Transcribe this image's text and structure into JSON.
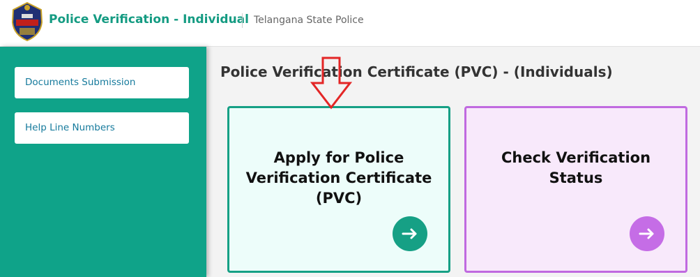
{
  "header": {
    "app_title": "Police Verification - Individual",
    "org_name": "Telangana State Police",
    "logo_icon": "police-badge-icon"
  },
  "sidebar": {
    "items": [
      {
        "label": "Documents Submission"
      },
      {
        "label": "Help Line Numbers"
      }
    ]
  },
  "main": {
    "title": "Police Verification Certificate (PVC) - (Individuals)",
    "cards": [
      {
        "title": "Apply for Police Verification Certificate (PVC)",
        "button_icon": "arrow-right-icon",
        "accent": "#16a085"
      },
      {
        "title": "Check Verification Status",
        "button_icon": "arrow-right-icon",
        "accent": "#c56de6"
      }
    ]
  },
  "annotation": {
    "icon": "red-down-arrow-icon",
    "color": "#e32626"
  },
  "colors": {
    "brand": "#149b82",
    "sidebar_bg": "#0fa389"
  }
}
